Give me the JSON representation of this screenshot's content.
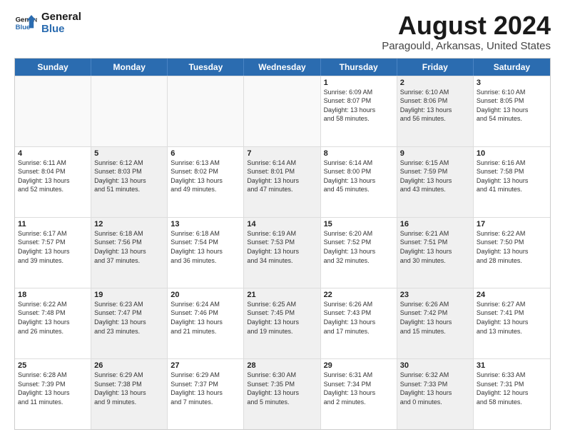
{
  "logo": {
    "line1": "General",
    "line2": "Blue"
  },
  "title": "August 2024",
  "subtitle": "Paragould, Arkansas, United States",
  "weekdays": [
    "Sunday",
    "Monday",
    "Tuesday",
    "Wednesday",
    "Thursday",
    "Friday",
    "Saturday"
  ],
  "rows": [
    [
      {
        "day": "",
        "text": "",
        "empty": true
      },
      {
        "day": "",
        "text": "",
        "empty": true
      },
      {
        "day": "",
        "text": "",
        "empty": true
      },
      {
        "day": "",
        "text": "",
        "empty": true
      },
      {
        "day": "1",
        "text": "Sunrise: 6:09 AM\nSunset: 8:07 PM\nDaylight: 13 hours\nand 58 minutes.",
        "shaded": false
      },
      {
        "day": "2",
        "text": "Sunrise: 6:10 AM\nSunset: 8:06 PM\nDaylight: 13 hours\nand 56 minutes.",
        "shaded": true
      },
      {
        "day": "3",
        "text": "Sunrise: 6:10 AM\nSunset: 8:05 PM\nDaylight: 13 hours\nand 54 minutes.",
        "shaded": false
      }
    ],
    [
      {
        "day": "4",
        "text": "Sunrise: 6:11 AM\nSunset: 8:04 PM\nDaylight: 13 hours\nand 52 minutes.",
        "shaded": false
      },
      {
        "day": "5",
        "text": "Sunrise: 6:12 AM\nSunset: 8:03 PM\nDaylight: 13 hours\nand 51 minutes.",
        "shaded": true
      },
      {
        "day": "6",
        "text": "Sunrise: 6:13 AM\nSunset: 8:02 PM\nDaylight: 13 hours\nand 49 minutes.",
        "shaded": false
      },
      {
        "day": "7",
        "text": "Sunrise: 6:14 AM\nSunset: 8:01 PM\nDaylight: 13 hours\nand 47 minutes.",
        "shaded": true
      },
      {
        "day": "8",
        "text": "Sunrise: 6:14 AM\nSunset: 8:00 PM\nDaylight: 13 hours\nand 45 minutes.",
        "shaded": false
      },
      {
        "day": "9",
        "text": "Sunrise: 6:15 AM\nSunset: 7:59 PM\nDaylight: 13 hours\nand 43 minutes.",
        "shaded": true
      },
      {
        "day": "10",
        "text": "Sunrise: 6:16 AM\nSunset: 7:58 PM\nDaylight: 13 hours\nand 41 minutes.",
        "shaded": false
      }
    ],
    [
      {
        "day": "11",
        "text": "Sunrise: 6:17 AM\nSunset: 7:57 PM\nDaylight: 13 hours\nand 39 minutes.",
        "shaded": false
      },
      {
        "day": "12",
        "text": "Sunrise: 6:18 AM\nSunset: 7:56 PM\nDaylight: 13 hours\nand 37 minutes.",
        "shaded": true
      },
      {
        "day": "13",
        "text": "Sunrise: 6:18 AM\nSunset: 7:54 PM\nDaylight: 13 hours\nand 36 minutes.",
        "shaded": false
      },
      {
        "day": "14",
        "text": "Sunrise: 6:19 AM\nSunset: 7:53 PM\nDaylight: 13 hours\nand 34 minutes.",
        "shaded": true
      },
      {
        "day": "15",
        "text": "Sunrise: 6:20 AM\nSunset: 7:52 PM\nDaylight: 13 hours\nand 32 minutes.",
        "shaded": false
      },
      {
        "day": "16",
        "text": "Sunrise: 6:21 AM\nSunset: 7:51 PM\nDaylight: 13 hours\nand 30 minutes.",
        "shaded": true
      },
      {
        "day": "17",
        "text": "Sunrise: 6:22 AM\nSunset: 7:50 PM\nDaylight: 13 hours\nand 28 minutes.",
        "shaded": false
      }
    ],
    [
      {
        "day": "18",
        "text": "Sunrise: 6:22 AM\nSunset: 7:48 PM\nDaylight: 13 hours\nand 26 minutes.",
        "shaded": false
      },
      {
        "day": "19",
        "text": "Sunrise: 6:23 AM\nSunset: 7:47 PM\nDaylight: 13 hours\nand 23 minutes.",
        "shaded": true
      },
      {
        "day": "20",
        "text": "Sunrise: 6:24 AM\nSunset: 7:46 PM\nDaylight: 13 hours\nand 21 minutes.",
        "shaded": false
      },
      {
        "day": "21",
        "text": "Sunrise: 6:25 AM\nSunset: 7:45 PM\nDaylight: 13 hours\nand 19 minutes.",
        "shaded": true
      },
      {
        "day": "22",
        "text": "Sunrise: 6:26 AM\nSunset: 7:43 PM\nDaylight: 13 hours\nand 17 minutes.",
        "shaded": false
      },
      {
        "day": "23",
        "text": "Sunrise: 6:26 AM\nSunset: 7:42 PM\nDaylight: 13 hours\nand 15 minutes.",
        "shaded": true
      },
      {
        "day": "24",
        "text": "Sunrise: 6:27 AM\nSunset: 7:41 PM\nDaylight: 13 hours\nand 13 minutes.",
        "shaded": false
      }
    ],
    [
      {
        "day": "25",
        "text": "Sunrise: 6:28 AM\nSunset: 7:39 PM\nDaylight: 13 hours\nand 11 minutes.",
        "shaded": false
      },
      {
        "day": "26",
        "text": "Sunrise: 6:29 AM\nSunset: 7:38 PM\nDaylight: 13 hours\nand 9 minutes.",
        "shaded": true
      },
      {
        "day": "27",
        "text": "Sunrise: 6:29 AM\nSunset: 7:37 PM\nDaylight: 13 hours\nand 7 minutes.",
        "shaded": false
      },
      {
        "day": "28",
        "text": "Sunrise: 6:30 AM\nSunset: 7:35 PM\nDaylight: 13 hours\nand 5 minutes.",
        "shaded": true
      },
      {
        "day": "29",
        "text": "Sunrise: 6:31 AM\nSunset: 7:34 PM\nDaylight: 13 hours\nand 2 minutes.",
        "shaded": false
      },
      {
        "day": "30",
        "text": "Sunrise: 6:32 AM\nSunset: 7:33 PM\nDaylight: 13 hours\nand 0 minutes.",
        "shaded": true
      },
      {
        "day": "31",
        "text": "Sunrise: 6:33 AM\nSunset: 7:31 PM\nDaylight: 12 hours\nand 58 minutes.",
        "shaded": false
      }
    ]
  ]
}
